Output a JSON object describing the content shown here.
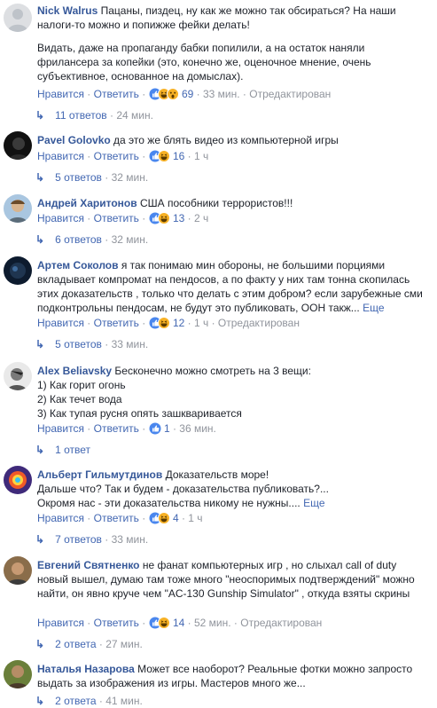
{
  "ui": {
    "like_label": "Нравится",
    "reply_label": "Ответить",
    "edited_label": "Отредактирован",
    "more_label": "Еще",
    "accent_color": "#4267b2",
    "author_color": "#365899",
    "meta_color": "#90949c"
  },
  "comments": [
    {
      "author": "Nick Walrus",
      "text": "Пацаны, пиздец, ну как же можно так обсираться? На наши налоги-то можно и попижже фейки делать!",
      "text2": "Видать, даже на пропаганду бабки попилили, а на остаток наняли фрилансера за копейки (это, конечно же, оценочное мнение, очень субъективное, основанное на домыслах).",
      "reactions": [
        "like-icon",
        "haha-icon",
        "wow-icon"
      ],
      "reaction_count": "69",
      "time": "33 мин.",
      "edited": true,
      "replies_text": "11 ответов",
      "replies_time": "24 мин."
    },
    {
      "author": "Pavel Golovko",
      "text": "да это же блять видео из компьютерной игры",
      "reactions": [
        "like-icon",
        "haha-icon"
      ],
      "reaction_count": "16",
      "time": "1 ч",
      "replies_text": "5 ответов",
      "replies_time": "32 мин."
    },
    {
      "author": "Андрей Харитонов",
      "text": "США пособники террористов!!!",
      "reactions": [
        "like-icon",
        "haha-icon"
      ],
      "reaction_count": "13",
      "time": "2 ч",
      "replies_text": "6 ответов",
      "replies_time": "32 мин."
    },
    {
      "author": "Артем Соколов",
      "text": "я так понимаю мин обороны, не большими порциями вкладывает компромат на пендосов, а по факту у них там тонна скопилась этих доказательств , только что делать с этим добром? если зарубежные сми подконтрольны пендосам, не будут это публиковать, ООН такж...",
      "has_more": true,
      "reactions": [
        "like-icon",
        "haha-icon"
      ],
      "reaction_count": "12",
      "time": "1 ч",
      "edited": true,
      "replies_text": "5 ответов",
      "replies_time": "33 мин."
    },
    {
      "author": "Alex Beliavsky",
      "text": "Бесконечно можно смотреть на 3 вещи:",
      "lines": [
        "1) Как горит огонь",
        "2) Как течет вода",
        "3) Как тупая русня опять зашкваривается"
      ],
      "reactions": [
        "like-icon"
      ],
      "reaction_count": "1",
      "time": "36 мин.",
      "replies_text": "1 ответ"
    },
    {
      "author": "Альберт Гильмутдинов",
      "text": "Доказательств море!",
      "lines": [
        "Дальше что? Так и будем - доказательства публиковать?...",
        "Окромя нас - эти доказательства никому не нужны...."
      ],
      "has_more": true,
      "reactions": [
        "like-icon",
        "haha-icon"
      ],
      "reaction_count": "4",
      "time": "1 ч",
      "replies_text": "7 ответов",
      "replies_time": "33 мин."
    },
    {
      "author": "Евгений Святненко",
      "text": "не фанат компьютерных игр , но слыхал call of duty новый вышел, думаю там тоже много \"неоспоримых подтверждений\" можно найти, он явно круче чем \"AC-130 Gunship Simulator\" , откуда взяты скрины",
      "reactions": [
        "like-icon",
        "haha-icon"
      ],
      "reaction_count": "14",
      "time": "52 мин.",
      "edited": true,
      "replies_text": "2 ответа",
      "replies_time": "27 мин."
    },
    {
      "author": "Наталья Назарова",
      "text": "Может все наоборот? Реальные фотки можно запросто выдать за изображения из игры. Мастеров много же...",
      "replies_text": "2 ответа",
      "replies_time": "41 мин."
    }
  ]
}
